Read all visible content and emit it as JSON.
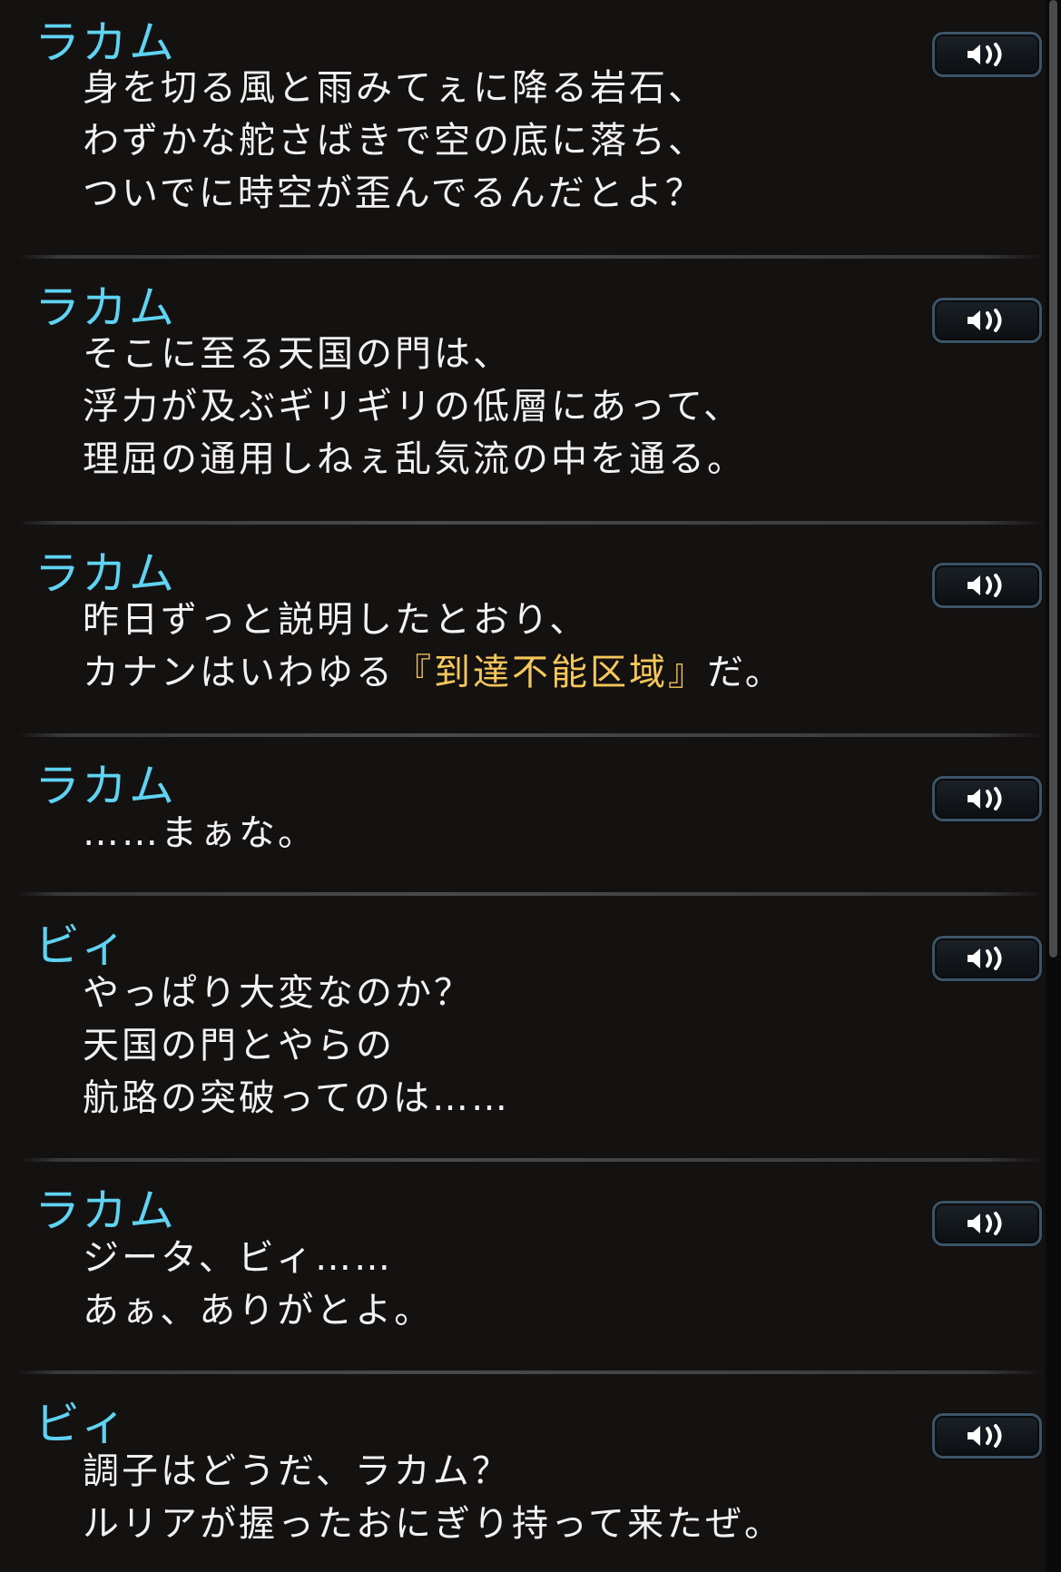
{
  "log": {
    "entries": [
      {
        "speaker": "ラカム",
        "lines": [
          "身を切る風と雨みてぇに降る岩石、",
          "わずかな舵さばきで空の底に落ち、",
          "ついでに時空が歪んでるんだとよ？"
        ]
      },
      {
        "speaker": "ラカム",
        "lines": [
          "そこに至る天国の門は、",
          "浮力が及ぶギリギリの低層にあって、",
          "理屈の通用しねぇ乱気流の中を通る。"
        ]
      },
      {
        "speaker": "ラカム",
        "lines": [
          "昨日ずっと説明したとおり、"
        ],
        "mixed_line": {
          "before": "カナンはいわゆる",
          "highlight": "『到達不能区域』",
          "after": "だ。"
        }
      },
      {
        "speaker": "ラカム",
        "lines": [
          "……まぁな。"
        ]
      },
      {
        "speaker": "ビィ",
        "lines": [
          "やっぱり大変なのか？",
          "天国の門とやらの",
          "航路の突破ってのは……"
        ]
      },
      {
        "speaker": "ラカム",
        "lines": [
          "ジータ、ビィ……",
          "あぁ、ありがとよ。"
        ]
      },
      {
        "speaker": "ビィ",
        "lines": [
          "調子はどうだ、ラカム？",
          "ルリアが握ったおにぎり持って来たぜ。"
        ]
      }
    ]
  },
  "icons": {
    "voice": "speaker-voice-icon"
  },
  "colors": {
    "speaker": "#5fd3f2",
    "text": "#f2f2f2",
    "highlight": "#f5c75b",
    "background": "#141111"
  }
}
